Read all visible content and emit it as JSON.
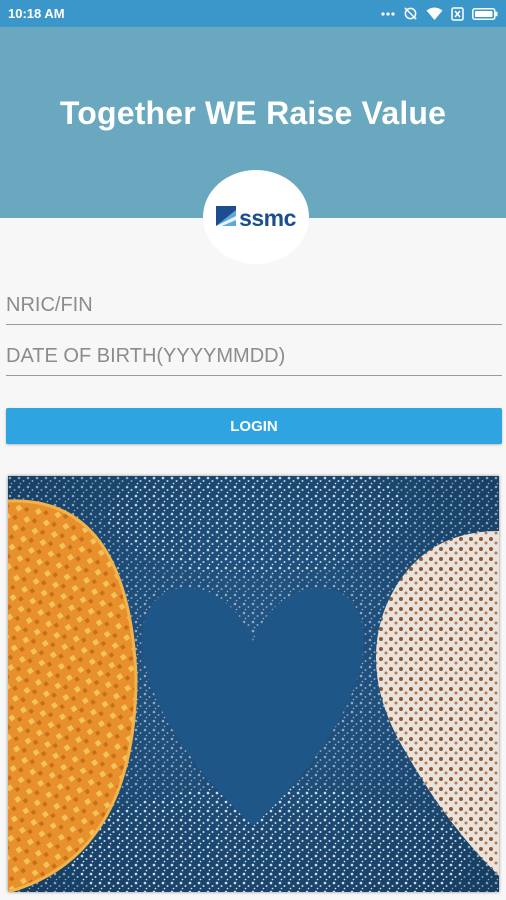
{
  "status_bar": {
    "time": "10:18 AM",
    "icons": [
      "dots-icon",
      "sync-off-icon",
      "wifi-icon",
      "sim-icon",
      "battery-icon"
    ]
  },
  "header": {
    "title": "Together WE Raise Value",
    "background": "#6aa8c0"
  },
  "logo": {
    "text": "ssmc",
    "color": "#1b4e8e"
  },
  "form": {
    "nric_placeholder": "NRIC/FIN",
    "dob_placeholder": "DATE OF BIRTH(YYYYMMDD)",
    "login_label": "LOGIN",
    "accent": "#2ea5e1"
  }
}
